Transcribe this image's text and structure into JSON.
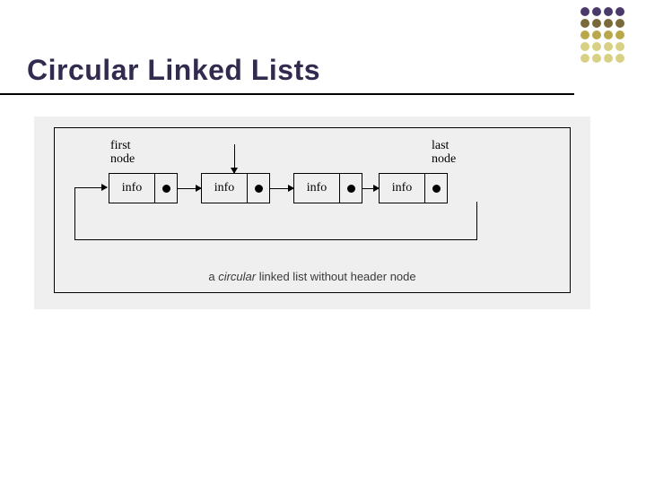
{
  "title": "Circular Linked Lists",
  "labels": {
    "first": "first\nnode",
    "last": "last\nnode"
  },
  "nodes": [
    {
      "info": "info"
    },
    {
      "info": "info"
    },
    {
      "info": "info"
    },
    {
      "info": "info"
    }
  ],
  "caption": {
    "prefix": "a ",
    "emph": "circular",
    "suffix": " linked list without header node"
  }
}
